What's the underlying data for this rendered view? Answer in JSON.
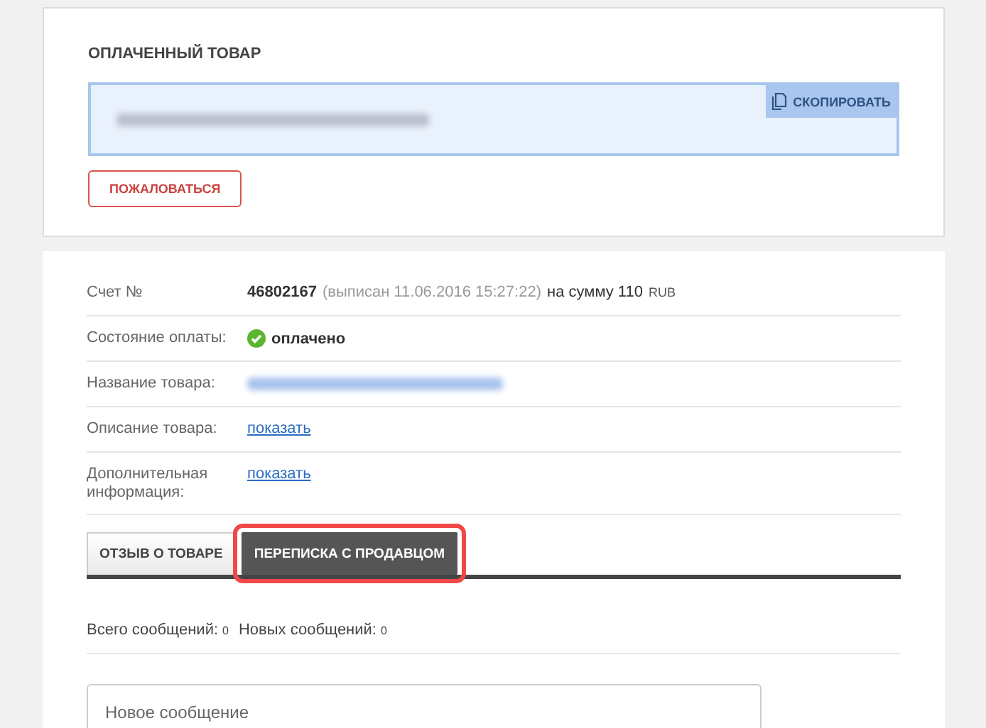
{
  "paid_item": {
    "title": "ОПЛАЧЕННЫЙ ТОВАР",
    "copy_button": "СКОПИРОВАТЬ",
    "complain_button": "ПОЖАЛОВАТЬСЯ"
  },
  "details": [
    {
      "kind": "invoice",
      "label": "Счет №",
      "number": "46802167",
      "issued": "(выписан 11.06.2016 15:27:22)",
      "amount": "на сумму 110",
      "currency": "RUB"
    },
    {
      "kind": "status",
      "label": "Состояние оплаты:",
      "value": "оплачено"
    },
    {
      "kind": "hidden",
      "label": "Название товара:"
    },
    {
      "kind": "link",
      "label": "Описание товара:",
      "value": "показать"
    },
    {
      "kind": "link",
      "label": "Дополнительная информация:",
      "value": "показать"
    }
  ],
  "tabs": [
    {
      "label": "ОТЗЫВ О ТОВАРЕ",
      "selected": false,
      "highlighted": false
    },
    {
      "label": "ПЕРЕПИСКА С ПРОДАВЦОМ",
      "selected": true,
      "highlighted": true
    }
  ],
  "counts": [
    {
      "label": "Всего сообщений:",
      "value": "0"
    },
    {
      "label": "Новых сообщений:",
      "value": "0"
    }
  ],
  "message": {
    "placeholder": "Новое сообщение"
  }
}
